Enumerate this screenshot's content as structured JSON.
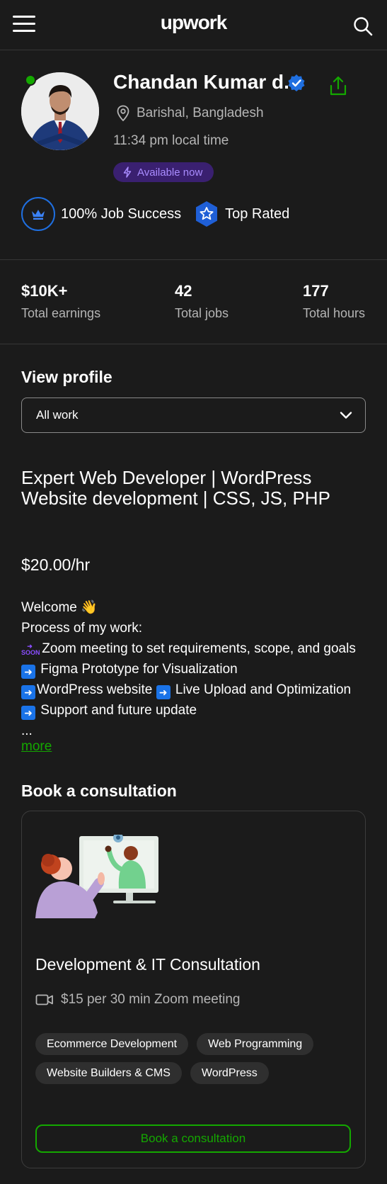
{
  "header": {
    "logo": "upwork",
    "menu_icon": "hamburger-icon",
    "search_icon": "search-icon"
  },
  "profile": {
    "name": "Chandan Kumar d.",
    "location": "Barishal, Bangladesh",
    "local_time": "11:34 pm local time",
    "availability": "Available now",
    "job_success": "100% Job Success",
    "top_rated": "Top Rated"
  },
  "stats": [
    {
      "value": "$10K+",
      "label": "Total earnings"
    },
    {
      "value": "42",
      "label": "Total jobs"
    },
    {
      "value": "177",
      "label": "Total hours"
    }
  ],
  "view_profile": {
    "heading": "View profile",
    "selected": "All work"
  },
  "listing": {
    "title": "Expert Web Developer | WordPress Website development | CSS, JS, PHP",
    "rate": "$20.00/hr",
    "welcome": "Welcome",
    "process_heading": "Process of my work:",
    "step1": "Zoom meeting to set requirements, scope, and goals",
    "step2": "Figma Prototype for Visualization",
    "step3": "WordPress website",
    "step4": "Live Upload and Optimization",
    "step5": "Support and future update",
    "ellipsis": "...",
    "more": "more"
  },
  "consultation": {
    "heading": "Book a consultation",
    "title": "Development & IT Consultation",
    "meta": "$15 per 30 min Zoom meeting",
    "tags": [
      "Ecommerce Development",
      "Web Programming",
      "Website Builders & CMS",
      "WordPress"
    ],
    "button": "Book a consultation"
  },
  "colors": {
    "accent": "#14a800",
    "verified": "#1f6fe0",
    "available_bg": "#3a2070",
    "available_text": "#a98cff",
    "background": "#1b1b1b"
  }
}
